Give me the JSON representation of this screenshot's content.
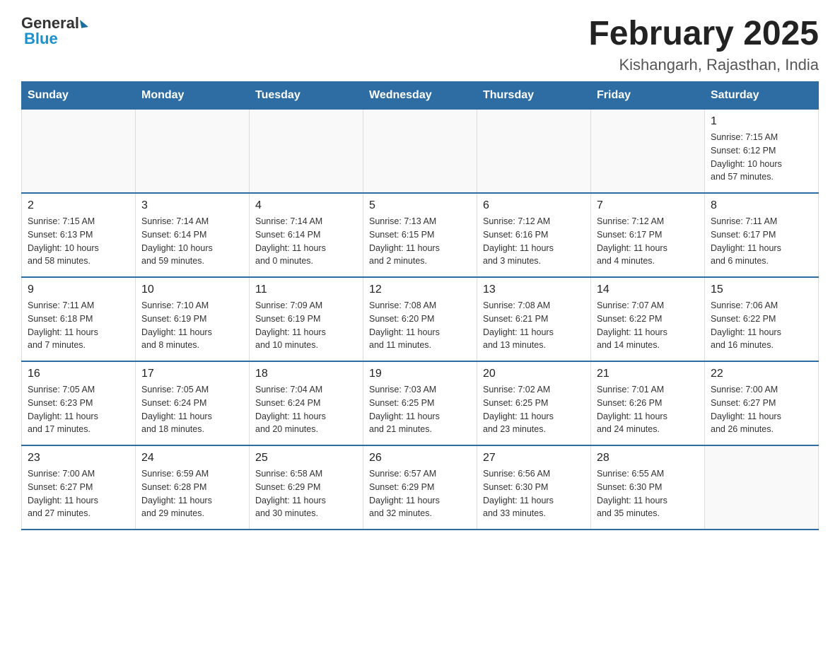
{
  "logo": {
    "general": "General",
    "blue": "Blue"
  },
  "title": "February 2025",
  "subtitle": "Kishangarh, Rajasthan, India",
  "days_of_week": [
    "Sunday",
    "Monday",
    "Tuesday",
    "Wednesday",
    "Thursday",
    "Friday",
    "Saturday"
  ],
  "weeks": [
    [
      {
        "day": "",
        "info": ""
      },
      {
        "day": "",
        "info": ""
      },
      {
        "day": "",
        "info": ""
      },
      {
        "day": "",
        "info": ""
      },
      {
        "day": "",
        "info": ""
      },
      {
        "day": "",
        "info": ""
      },
      {
        "day": "1",
        "info": "Sunrise: 7:15 AM\nSunset: 6:12 PM\nDaylight: 10 hours\nand 57 minutes."
      }
    ],
    [
      {
        "day": "2",
        "info": "Sunrise: 7:15 AM\nSunset: 6:13 PM\nDaylight: 10 hours\nand 58 minutes."
      },
      {
        "day": "3",
        "info": "Sunrise: 7:14 AM\nSunset: 6:14 PM\nDaylight: 10 hours\nand 59 minutes."
      },
      {
        "day": "4",
        "info": "Sunrise: 7:14 AM\nSunset: 6:14 PM\nDaylight: 11 hours\nand 0 minutes."
      },
      {
        "day": "5",
        "info": "Sunrise: 7:13 AM\nSunset: 6:15 PM\nDaylight: 11 hours\nand 2 minutes."
      },
      {
        "day": "6",
        "info": "Sunrise: 7:12 AM\nSunset: 6:16 PM\nDaylight: 11 hours\nand 3 minutes."
      },
      {
        "day": "7",
        "info": "Sunrise: 7:12 AM\nSunset: 6:17 PM\nDaylight: 11 hours\nand 4 minutes."
      },
      {
        "day": "8",
        "info": "Sunrise: 7:11 AM\nSunset: 6:17 PM\nDaylight: 11 hours\nand 6 minutes."
      }
    ],
    [
      {
        "day": "9",
        "info": "Sunrise: 7:11 AM\nSunset: 6:18 PM\nDaylight: 11 hours\nand 7 minutes."
      },
      {
        "day": "10",
        "info": "Sunrise: 7:10 AM\nSunset: 6:19 PM\nDaylight: 11 hours\nand 8 minutes."
      },
      {
        "day": "11",
        "info": "Sunrise: 7:09 AM\nSunset: 6:19 PM\nDaylight: 11 hours\nand 10 minutes."
      },
      {
        "day": "12",
        "info": "Sunrise: 7:08 AM\nSunset: 6:20 PM\nDaylight: 11 hours\nand 11 minutes."
      },
      {
        "day": "13",
        "info": "Sunrise: 7:08 AM\nSunset: 6:21 PM\nDaylight: 11 hours\nand 13 minutes."
      },
      {
        "day": "14",
        "info": "Sunrise: 7:07 AM\nSunset: 6:22 PM\nDaylight: 11 hours\nand 14 minutes."
      },
      {
        "day": "15",
        "info": "Sunrise: 7:06 AM\nSunset: 6:22 PM\nDaylight: 11 hours\nand 16 minutes."
      }
    ],
    [
      {
        "day": "16",
        "info": "Sunrise: 7:05 AM\nSunset: 6:23 PM\nDaylight: 11 hours\nand 17 minutes."
      },
      {
        "day": "17",
        "info": "Sunrise: 7:05 AM\nSunset: 6:24 PM\nDaylight: 11 hours\nand 18 minutes."
      },
      {
        "day": "18",
        "info": "Sunrise: 7:04 AM\nSunset: 6:24 PM\nDaylight: 11 hours\nand 20 minutes."
      },
      {
        "day": "19",
        "info": "Sunrise: 7:03 AM\nSunset: 6:25 PM\nDaylight: 11 hours\nand 21 minutes."
      },
      {
        "day": "20",
        "info": "Sunrise: 7:02 AM\nSunset: 6:25 PM\nDaylight: 11 hours\nand 23 minutes."
      },
      {
        "day": "21",
        "info": "Sunrise: 7:01 AM\nSunset: 6:26 PM\nDaylight: 11 hours\nand 24 minutes."
      },
      {
        "day": "22",
        "info": "Sunrise: 7:00 AM\nSunset: 6:27 PM\nDaylight: 11 hours\nand 26 minutes."
      }
    ],
    [
      {
        "day": "23",
        "info": "Sunrise: 7:00 AM\nSunset: 6:27 PM\nDaylight: 11 hours\nand 27 minutes."
      },
      {
        "day": "24",
        "info": "Sunrise: 6:59 AM\nSunset: 6:28 PM\nDaylight: 11 hours\nand 29 minutes."
      },
      {
        "day": "25",
        "info": "Sunrise: 6:58 AM\nSunset: 6:29 PM\nDaylight: 11 hours\nand 30 minutes."
      },
      {
        "day": "26",
        "info": "Sunrise: 6:57 AM\nSunset: 6:29 PM\nDaylight: 11 hours\nand 32 minutes."
      },
      {
        "day": "27",
        "info": "Sunrise: 6:56 AM\nSunset: 6:30 PM\nDaylight: 11 hours\nand 33 minutes."
      },
      {
        "day": "28",
        "info": "Sunrise: 6:55 AM\nSunset: 6:30 PM\nDaylight: 11 hours\nand 35 minutes."
      },
      {
        "day": "",
        "info": ""
      }
    ]
  ]
}
